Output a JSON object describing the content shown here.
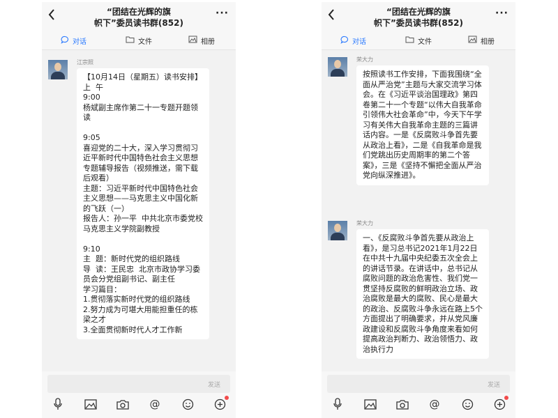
{
  "colors": {
    "accent": "#2979ff",
    "badge": "#f24b4b",
    "bubble": "#ffffff",
    "chat_bg": "#f2f2f2"
  },
  "phones": [
    {
      "header": {
        "back_icon": "chevron-left-icon",
        "title": "“团结在光辉的旗\n帜下”委员读书群(852)",
        "more_label": "···"
      },
      "tabs": [
        {
          "label": "对话",
          "icon": "chat-bubble-icon",
          "active": true
        },
        {
          "label": "文件",
          "icon": "folder-icon",
          "active": false
        },
        {
          "label": "相册",
          "icon": "image-icon",
          "active": false
        }
      ],
      "messages": [
        {
          "sender": "江宗照",
          "text": "【10月14日（星期五）读书安排】\n上  午\n9:00\n杨斌副主席作第二十一专题开题领读\n\n9:05\n喜迎党的二十大，深入学习贯彻习近平新时代中国特色社会主义思想专题辅导报告（视频推送，需下载后观看）\n主题：习近平新时代中国特色社会主义思想——马克思主义中国化新的飞跃（一）\n报告人：孙一平  中共北京市委党校马克思主义学院副教授\n\n9:10\n主  题：新时代党的组织路线\n导  读：王民忠  北京市政协学习委员会分党组副书记、副主任\n学习篇目：\n1.贯彻落实新时代党的组织路线\n2.努力成为可堪大用能担重任的栋梁之才\n3.全面贯彻新时代人才工作新"
        }
      ],
      "input": {
        "send_label": "发送"
      },
      "toolbar": [
        "microphone-icon",
        "image-icon",
        "camera-icon",
        "at-icon",
        "emoji-icon",
        "plus-icon"
      ]
    },
    {
      "header": {
        "back_icon": "chevron-left-icon",
        "title": "“团结在光辉的旗\n帜下”委员读书群(852)",
        "more_label": "···"
      },
      "tabs": [
        {
          "label": "对话",
          "icon": "chat-bubble-icon",
          "active": true
        },
        {
          "label": "文件",
          "icon": "folder-icon",
          "active": false
        },
        {
          "label": "相册",
          "icon": "image-icon",
          "active": false
        }
      ],
      "messages": [
        {
          "sender": "荣大力",
          "text": "按照读书工作安排，下面我围绕“全面从严治党”主题与大家交流学习体会。在《习近平谈治国理政》第四卷第二十一个专题“以伟大自我革命引领伟大社会革命”中，今天下午学习有关伟大自我革命主题的三篇讲话内容。一是《反腐败斗争首先要从政治上看》，二是《自我革命是我们党跳出历史周期率的第二个答案》，三是《坚持不懈把全面从严治党向纵深推进》。"
        },
        {
          "sender": "荣大力",
          "text": "一、《反腐败斗争首先要从政治上看》，是习总书记2021年1月22日在中共十九届中央纪委五次全会上的讲话节录。在讲话中，总书记从腐败问题的政治危害性、我们党一贯坚持反腐败的鲜明政治立场、政治腐败是最大的腐败、民心是最大的政治、反腐败斗争永远在路上5个方面提出了明确要求，并从党风廉政建设和反腐败斗争角度来看如何提高政治判断力、政治领悟力、政治执行力"
        }
      ],
      "input": {
        "send_label": "发送"
      },
      "toolbar": [
        "microphone-icon",
        "image-icon",
        "camera-icon",
        "at-icon",
        "emoji-icon",
        "plus-icon"
      ]
    }
  ]
}
